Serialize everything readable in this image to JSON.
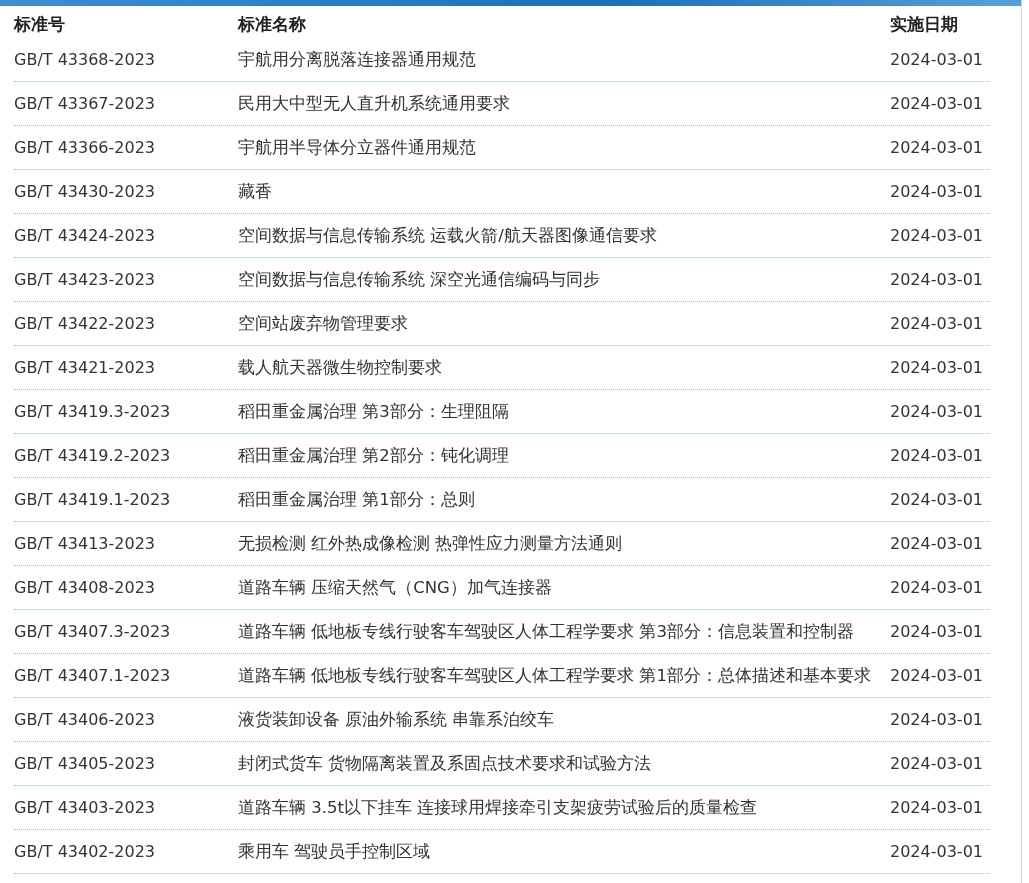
{
  "table": {
    "columns": [
      "标准号",
      "标准名称",
      "实施日期"
    ],
    "rows": [
      {
        "number": "GB/T 43368-2023",
        "name": "宇航用分离脱落连接器通用规范",
        "date": "2024-03-01"
      },
      {
        "number": "GB/T 43367-2023",
        "name": "民用大中型无人直升机系统通用要求",
        "date": "2024-03-01"
      },
      {
        "number": "GB/T 43366-2023",
        "name": "宇航用半导体分立器件通用规范",
        "date": "2024-03-01"
      },
      {
        "number": "GB/T 43430-2023",
        "name": "藏香",
        "date": "2024-03-01"
      },
      {
        "number": "GB/T 43424-2023",
        "name": "空间数据与信息传输系统 运载火箭/航天器图像通信要求",
        "date": "2024-03-01"
      },
      {
        "number": "GB/T 43423-2023",
        "name": "空间数据与信息传输系统 深空光通信编码与同步",
        "date": "2024-03-01"
      },
      {
        "number": "GB/T 43422-2023",
        "name": "空间站废弃物管理要求",
        "date": "2024-03-01"
      },
      {
        "number": "GB/T 43421-2023",
        "name": "载人航天器微生物控制要求",
        "date": "2024-03-01"
      },
      {
        "number": "GB/T 43419.3-2023",
        "name": "稻田重金属治理 第3部分：生理阻隔",
        "date": "2024-03-01"
      },
      {
        "number": "GB/T 43419.2-2023",
        "name": "稻田重金属治理 第2部分：钝化调理",
        "date": "2024-03-01"
      },
      {
        "number": "GB/T 43419.1-2023",
        "name": "稻田重金属治理 第1部分：总则",
        "date": "2024-03-01"
      },
      {
        "number": "GB/T 43413-2023",
        "name": "无损检测 红外热成像检测 热弹性应力测量方法通则",
        "date": "2024-03-01"
      },
      {
        "number": "GB/T 43408-2023",
        "name": "道路车辆 压缩天然气（CNG）加气连接器",
        "date": "2024-03-01"
      },
      {
        "number": "GB/T 43407.3-2023",
        "name": "道路车辆 低地板专线行驶客车驾驶区人体工程学要求 第3部分：信息装置和控制器",
        "date": "2024-03-01"
      },
      {
        "number": "GB/T 43407.1-2023",
        "name": "道路车辆 低地板专线行驶客车驾驶区人体工程学要求 第1部分：总体描述和基本要求",
        "date": "2024-03-01"
      },
      {
        "number": "GB/T 43406-2023",
        "name": "液货装卸设备 原油外输系统 串靠系泊绞车",
        "date": "2024-03-01"
      },
      {
        "number": "GB/T 43405-2023",
        "name": "封闭式货车 货物隔离装置及系固点技术要求和试验方法",
        "date": "2024-03-01"
      },
      {
        "number": "GB/T 43403-2023",
        "name": "道路车辆 3.5t以下挂车 连接球用焊接牵引支架疲劳试验后的质量检查",
        "date": "2024-03-01"
      },
      {
        "number": "GB/T 43402-2023",
        "name": "乘用车 驾驶员手控制区域",
        "date": "2024-03-01"
      }
    ]
  }
}
